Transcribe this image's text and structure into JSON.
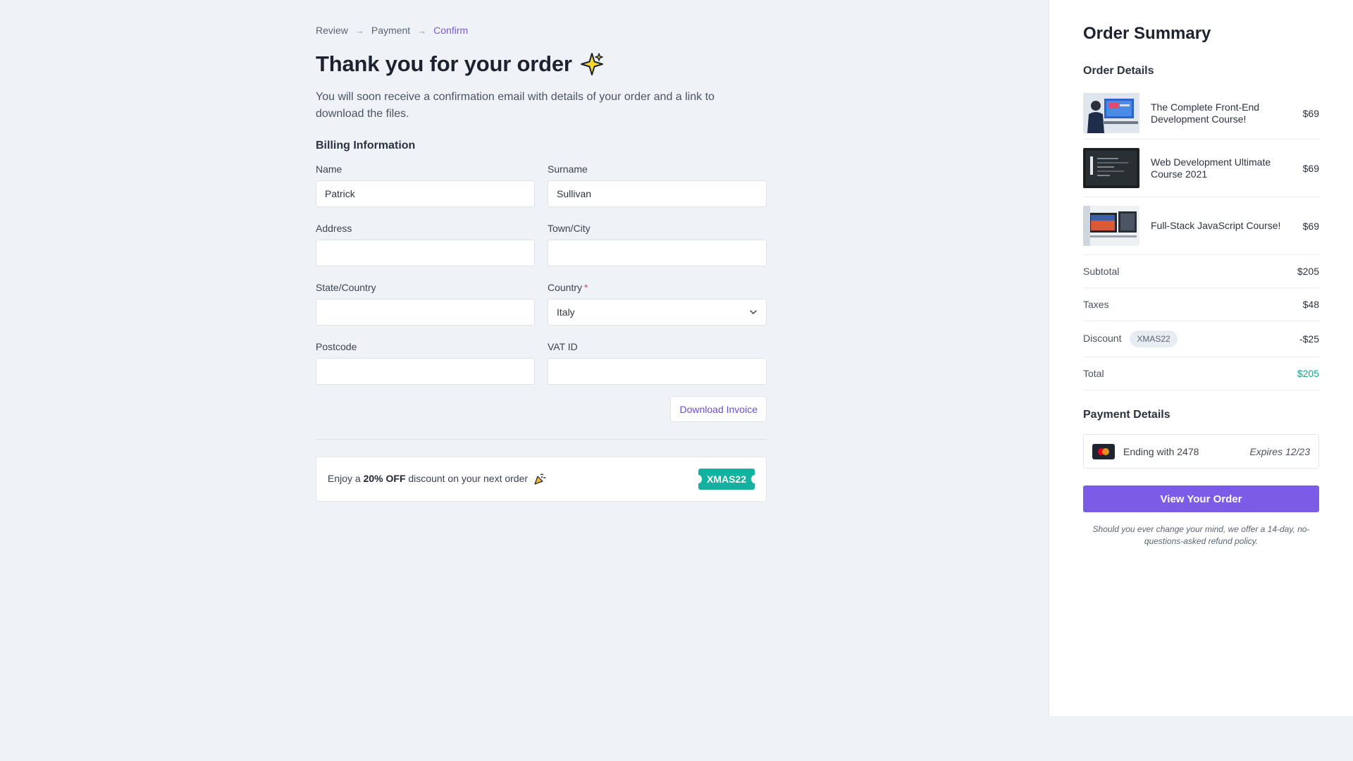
{
  "breadcrumb": [
    "Review",
    "Payment",
    "Confirm"
  ],
  "title": "Thank you for your order",
  "subtitle": "You will soon receive a confirmation email with details of your order and a link to download the files.",
  "billing": {
    "section_title": "Billing Information",
    "fields": {
      "name": {
        "label": "Name",
        "value": "Patrick"
      },
      "surname": {
        "label": "Surname",
        "value": "Sullivan"
      },
      "address": {
        "label": "Address",
        "value": ""
      },
      "town": {
        "label": "Town/City",
        "value": ""
      },
      "state": {
        "label": "State/Country",
        "value": ""
      },
      "country": {
        "label": "Country",
        "required_mark": "*",
        "value": "Italy"
      },
      "postcode": {
        "label": "Postcode",
        "value": ""
      },
      "vat": {
        "label": "VAT ID",
        "value": ""
      }
    },
    "download_label": "Download Invoice"
  },
  "promo": {
    "prefix": "Enjoy a",
    "highlight": "20% OFF",
    "suffix": "discount on your next order",
    "code": "XMAS22"
  },
  "summary": {
    "title": "Order Summary",
    "details_title": "Order Details",
    "items": [
      {
        "name": "The Complete Front-End Development Course!",
        "price": "$69"
      },
      {
        "name": "Web Development Ultimate Course 2021",
        "price": "$69"
      },
      {
        "name": "Full-Stack JavaScript Course!",
        "price": "$69"
      }
    ],
    "subtotal": {
      "label": "Subtotal",
      "value": "$205"
    },
    "taxes": {
      "label": "Taxes",
      "value": "$48"
    },
    "discount": {
      "label": "Discount",
      "code": "XMAS22",
      "value": "-$25"
    },
    "total": {
      "label": "Total",
      "value": "$205"
    },
    "payment_title": "Payment Details",
    "card": {
      "ending": "Ending with 2478",
      "expires": "Expires 12/23"
    },
    "view_order_label": "View Your Order",
    "refund_note": "Should you ever change your mind, we offer a 14-day, no-questions-asked refund policy."
  },
  "colors": {
    "accent": "#7c5ce6",
    "coupon": "#13b19f",
    "total": "#12a58b"
  },
  "icons": [
    "arrow-right-icon",
    "sparkle-icon",
    "chevron-down-icon",
    "party-popper-icon",
    "mastercard-icon"
  ]
}
